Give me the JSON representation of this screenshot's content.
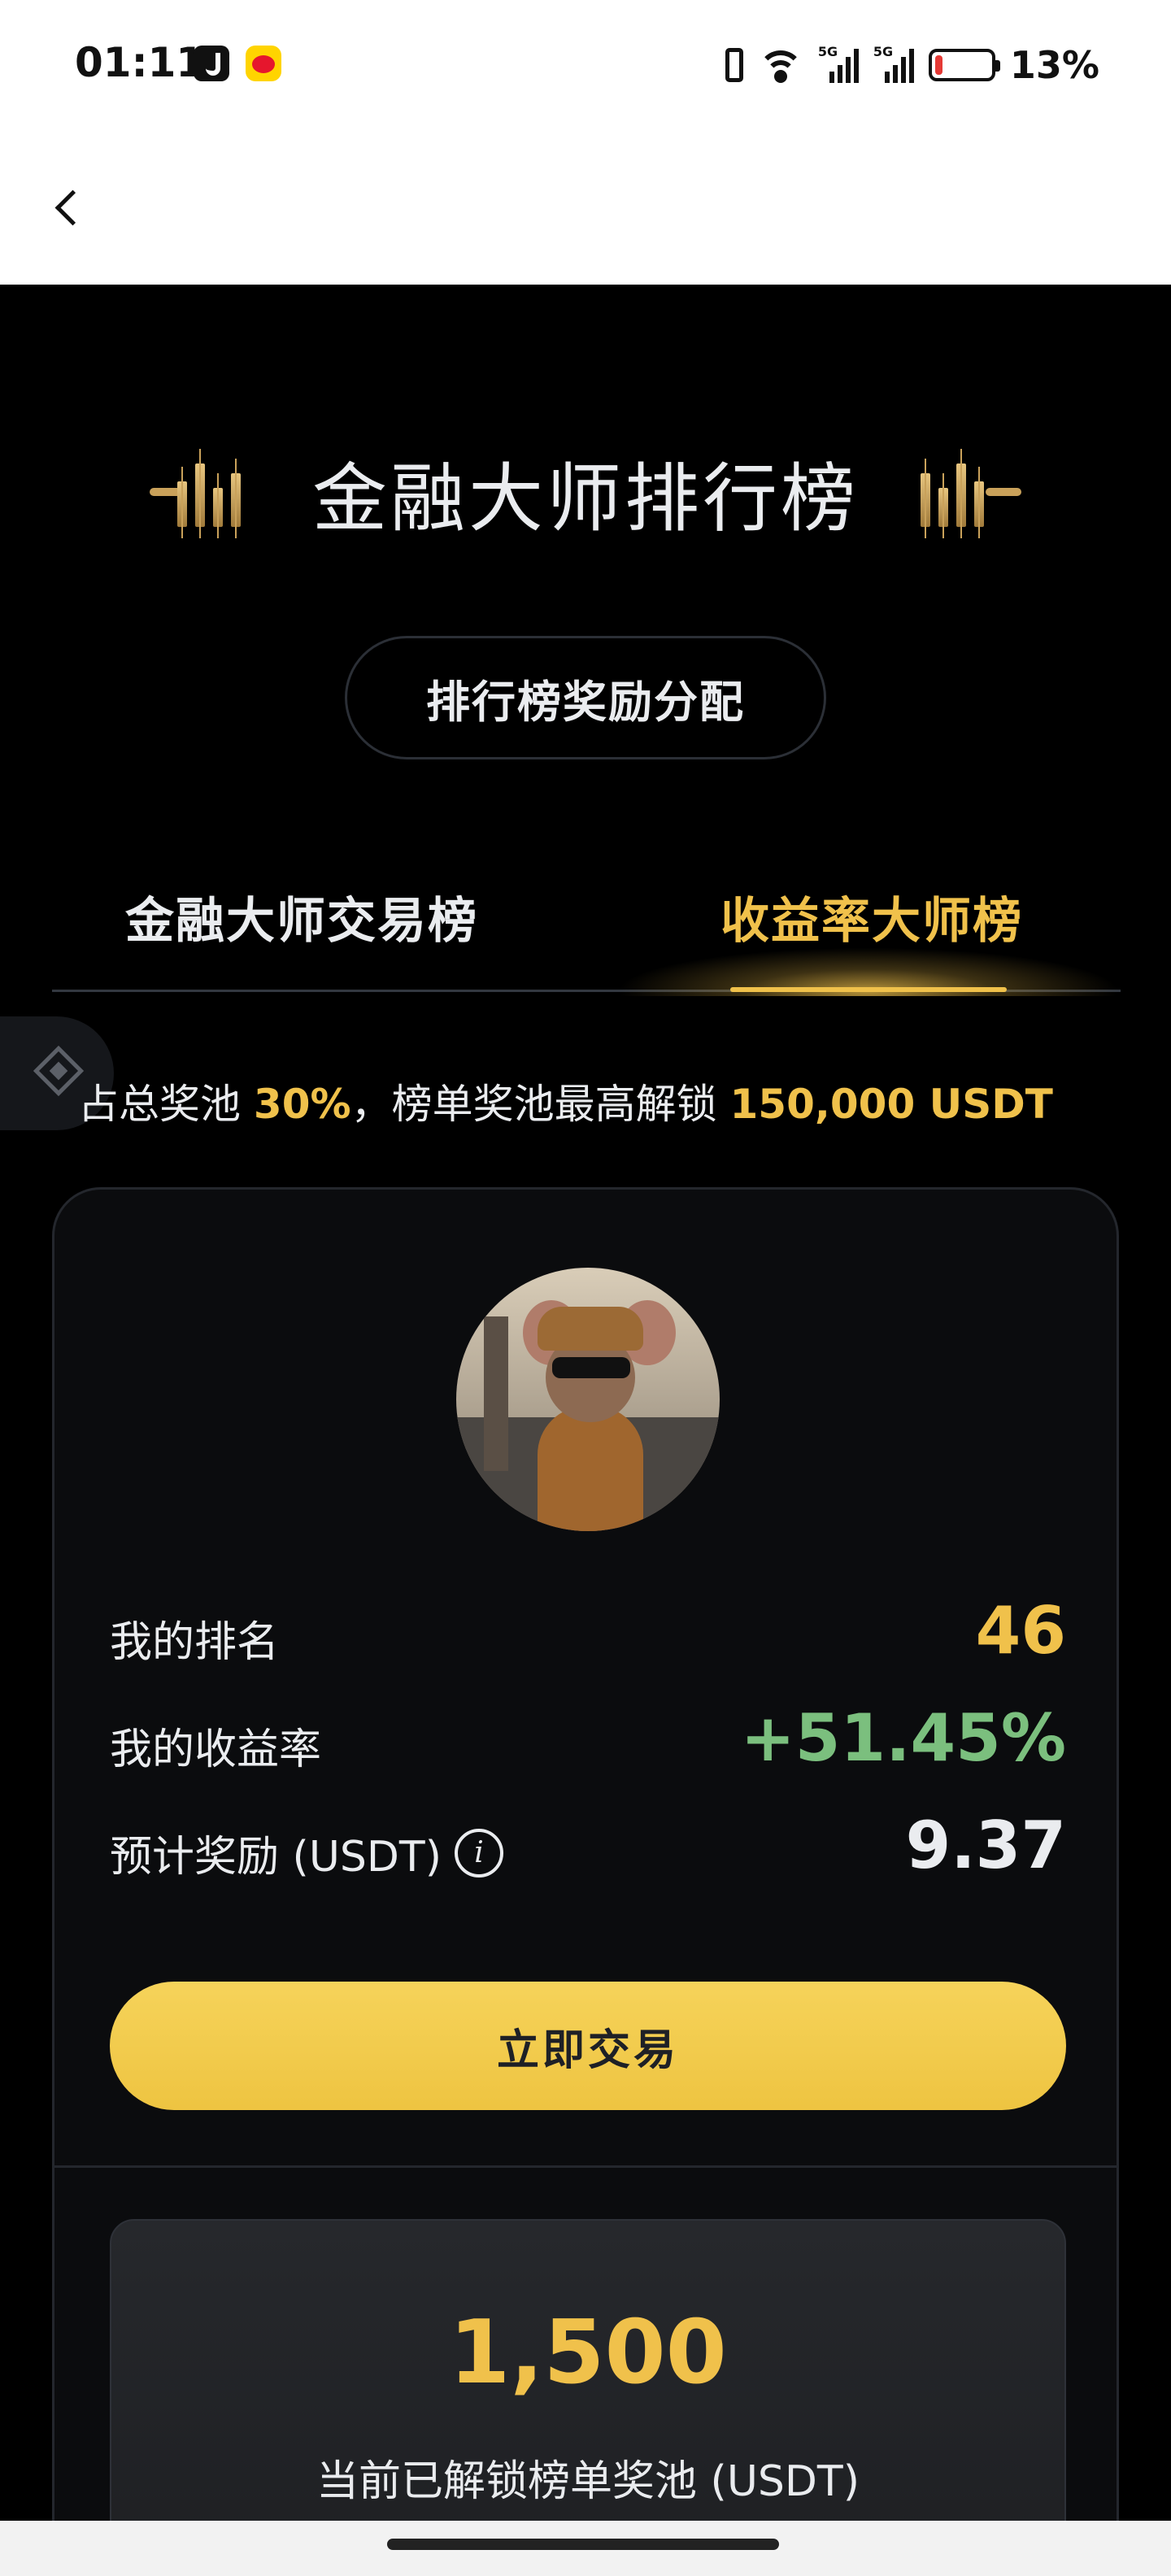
{
  "status_bar": {
    "time": "01:11",
    "signal_1": "5G",
    "signal_2": "5G",
    "battery_percent": "13%",
    "battery_level": 0.13,
    "battery_color": "#e53935",
    "icons": [
      "tiktok-icon",
      "weibo-icon",
      "vibrate-icon",
      "wifi-icon",
      "signal-icon",
      "battery-icon"
    ]
  },
  "header": {
    "back_icon": "chevron-left-icon"
  },
  "page": {
    "title": "金融大师排行榜",
    "reward_button_label": "排行榜奖励分配",
    "tabs": [
      {
        "label": "金融大师交易榜",
        "active": false
      },
      {
        "label": "收益率大师榜",
        "active": true
      }
    ],
    "pool_note": {
      "prefix": "占总奖池 ",
      "percent": "30%",
      "middle": "，榜单奖池最高解锁 ",
      "max_amount": "150,000 USDT"
    }
  },
  "my_card": {
    "my_rank_label": "我的排名",
    "my_rank_value": "46",
    "my_yield_label": "我的收益率",
    "my_yield_value": "+51.45%",
    "est_reward_label": "预计奖励 (USDT)",
    "est_reward_value": "9.37",
    "trade_button_label": "立即交易",
    "unlocked_pool_amount": "1,500",
    "unlocked_pool_label": "当前已解锁榜单奖池 (USDT)"
  },
  "colors": {
    "accent_gold": "#f0c14b",
    "positive_green": "#7bbf7e",
    "background": "#000000",
    "text": "#eaecef"
  }
}
